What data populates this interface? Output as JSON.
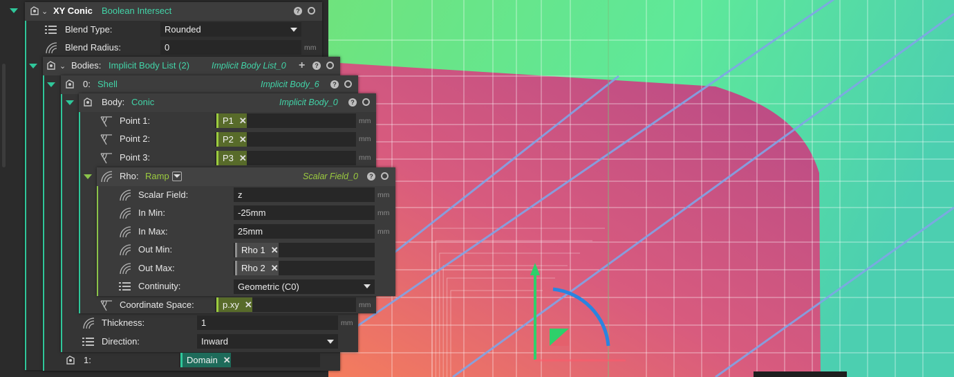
{
  "colors": {
    "accent_teal": "#2fc79a",
    "accent_lime": "#8bc34a",
    "chip_olive": "#586b2a",
    "chip_gray": "#4a4a4a",
    "chip_teal": "#1e6b5a",
    "tag_teal": "#42d4a8",
    "tag_lime": "#9ccc3f",
    "field_bg": "#272727"
  },
  "root": {
    "name": "XY Conic",
    "type": "Boolean Intersect",
    "blend_type_label": "Blend Type:",
    "blend_type_value": "Rounded",
    "blend_radius_label": "Blend Radius:",
    "blend_radius_value": "0",
    "blend_radius_unit": "mm"
  },
  "bodies": {
    "label": "Bodies:",
    "type": "Implicit Body List (2)",
    "tag": "Implicit Body List_0"
  },
  "shell": {
    "label": "0:",
    "type": "Shell",
    "tag": "Implicit Body_6",
    "thickness_label": "Thickness:",
    "thickness_value": "1",
    "thickness_unit": "mm",
    "direction_label": "Direction:",
    "direction_value": "Inward"
  },
  "body": {
    "label": "Body:",
    "type": "Conic",
    "tag": "Implicit Body_0",
    "points": [
      {
        "label": "Point 1:",
        "value": "P1",
        "unit": "mm"
      },
      {
        "label": "Point 2:",
        "value": "P2",
        "unit": "mm"
      },
      {
        "label": "Point 3:",
        "value": "P3",
        "unit": "mm"
      }
    ],
    "coord_label": "Coordinate Space:",
    "coord_value": "p.xy",
    "coord_unit": "mm"
  },
  "rho": {
    "label": "Rho:",
    "type": "Ramp",
    "tag": "Scalar Field_0",
    "scalar_field_label": "Scalar Field:",
    "scalar_field_value": "z",
    "in_min_label": "In Min:",
    "in_min_value": "-25mm",
    "in_max_label": "In Max:",
    "in_max_value": "25mm",
    "out_min_label": "Out Min:",
    "out_min_value": "Rho 1",
    "out_max_label": "Out Max:",
    "out_max_value": "Rho 2",
    "continuity_label": "Continuity:",
    "continuity_value": "Geometric (C0)",
    "unit": "mm"
  },
  "item1": {
    "label": "1:",
    "value": "Domain"
  }
}
